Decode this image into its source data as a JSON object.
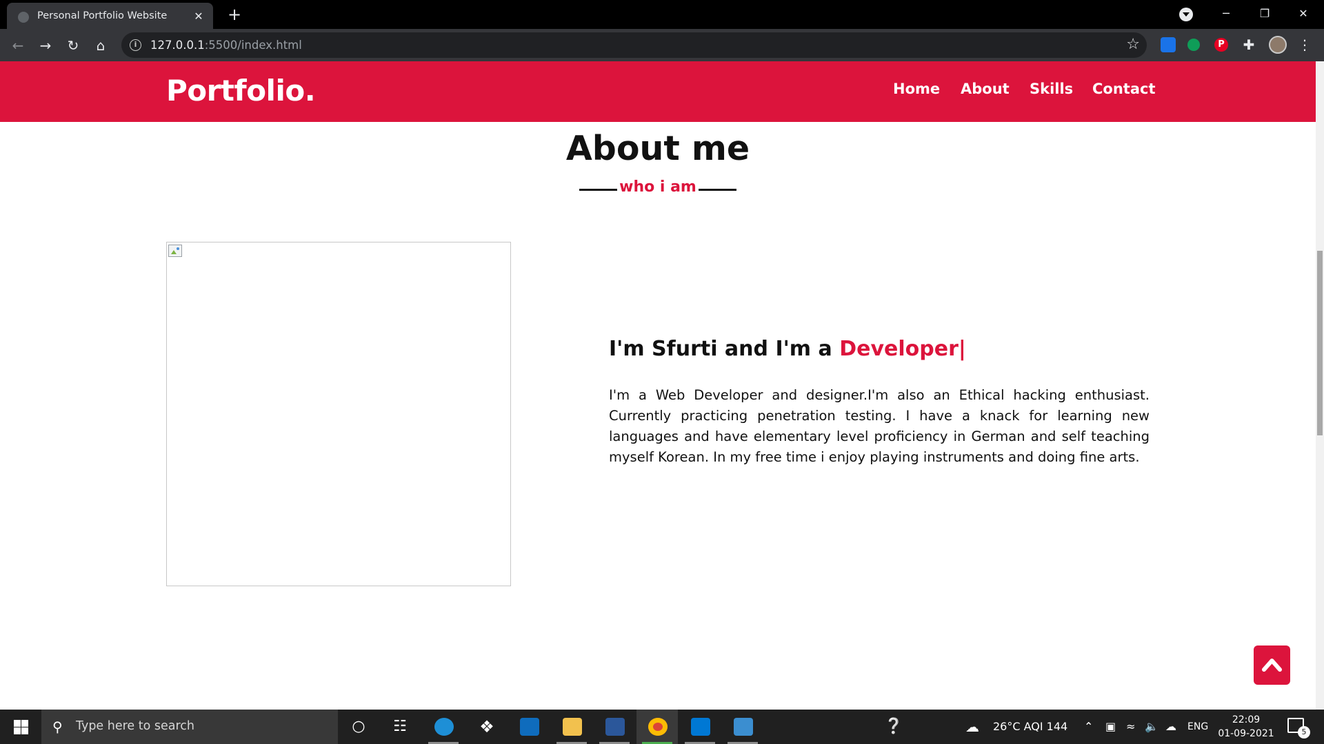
{
  "browser": {
    "tab_title": "Personal Portfolio Website",
    "tab_close": "✕",
    "new_tab": "+",
    "url_host": "127.0.0.1",
    "url_path": ":5500/index.html",
    "window_controls": {
      "minimize": "─",
      "restore": "❐",
      "close": "✕"
    },
    "extensions": [
      "tab-manager-icon",
      "green-dot-extension-icon",
      "pinterest-icon",
      "extensions-puzzle-icon"
    ],
    "pinterest_glyph": "P",
    "puzzle_glyph": "✚",
    "menu_glyph": "⋮",
    "star_glyph": "☆"
  },
  "site": {
    "brand": "Portfolio.",
    "nav": [
      "Home",
      "About",
      "Skills",
      "Contact"
    ],
    "accent_color": "#dc143c"
  },
  "about": {
    "title": "About me",
    "subtitle": "who i am",
    "heading_prefix": "I'm Sfurti and I'm a ",
    "heading_typed": "Developer|",
    "body": "I'm a Web Developer and designer.I'm also an Ethical hacking enthusiast. Currently practicing penetration testing. I have a knack for learning new languages and have elementary level proficiency in German and self teaching myself Korean. In my free time i enjoy playing instruments and doing fine arts."
  },
  "taskbar": {
    "search_placeholder": "Type here to search",
    "weather": "26°C  AQI 144",
    "language": "ENG",
    "time": "22:09",
    "date": "01-09-2021",
    "notification_count": "5",
    "pinned": [
      "cortana-icon",
      "task-view-icon",
      "edge-icon",
      "dropbox-icon",
      "mail-icon",
      "file-explorer-icon",
      "word-icon",
      "chrome-icon",
      "vscode-icon",
      "photos-icon"
    ]
  }
}
